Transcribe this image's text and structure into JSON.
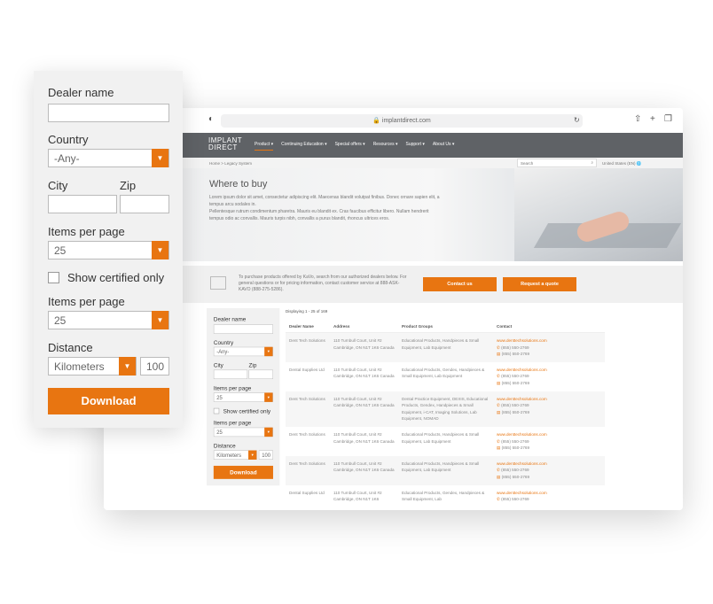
{
  "browser": {
    "url": "implantdirect.com"
  },
  "nav": {
    "logo_line1": "IMPLANT",
    "logo_line2": "DIRECT",
    "items": [
      "Product ▾",
      "Continuing Education ▾",
      "Special offers ▾",
      "Resources ▾",
      "Support ▾",
      "About Us ▾"
    ]
  },
  "breadcrumb": {
    "home": "Home",
    "sep": ">",
    "current": "Legacy System",
    "search_placeholder": "Search",
    "region": "United States (EN)"
  },
  "hero": {
    "title": "Where to buy",
    "p1": "Lorem ipsum dolor sit amet, consectetur adipiscing elit. Maecenas blandit volutpat finibus. Donec ornare sapien elit, a tempus arcu sodales in.",
    "p2": "Pellentesque rutrum condimentum pharetra. Mauris eu blandit ex. Cras faucibus efficitur libero. Nullam hendrerit tempus odio ac convallis. Mauris turpis nibh, convallis a purus blandit, rhoncus ultrices eros."
  },
  "contact_bar": {
    "text": "To purchase products offered by KaVo, search from our authorized dealers below. For general questions or for pricing information, contact customer service at 888-ASK-KAVO (888-275-5286).",
    "contact_button": "Contact us",
    "quote_button": "Request a quote"
  },
  "filters": {
    "dealer_name_label": "Dealer name",
    "dealer_name_value": "",
    "country_label": "Country",
    "country_value": "-Any-",
    "city_label": "City",
    "zip_label": "Zip",
    "items_label": "Items per page",
    "items_value": "25",
    "certified_label": "Show certified only",
    "items2_label": "Items per page",
    "items2_value": "25",
    "distance_label": "Distance",
    "distance_unit": "Kilometers",
    "distance_value": "100",
    "download": "Download"
  },
  "results": {
    "displaying": "Displaying 1 - 25 of 169",
    "headers": [
      "Dealer Name",
      "Address",
      "Product Groups",
      "Contact"
    ],
    "rows": [
      {
        "name": "Dent Tech Solutions",
        "address": "110 Turnbull Court, Unit #2 Cambridge, ON N1T 1K6 Canada",
        "groups": "Educational Products, Handpieces & Small Equipment, Lab Equipment",
        "web": "www.denttechsolutions.com",
        "phone": "(855) 550-2769",
        "fax": "(855) 550-2769"
      },
      {
        "name": "Dental Supplies Ltd",
        "address": "110 Turnbull Court, Unit #2 Cambridge, ON N1T 1K6 Canada",
        "groups": "Educational Products, Gendex, Handpieces & Small Equipment, Lab Equipment",
        "web": "www.denttechsolutions.com",
        "phone": "(855) 550-2769",
        "fax": "(855) 550-2769"
      },
      {
        "name": "Dent Tech Solutions",
        "address": "110 Turnbull Court, Unit #2 Cambridge, ON N1T 1K6 Canada",
        "groups": "Dental Practice Equipment, DEXIS, Educational Products, Gendex, Handpieces & Small Equipment, i-CAT, Imaging Solutions, Lab Equipment, NOMAD",
        "web": "www.denttechsolutions.com",
        "phone": "(855) 550-2769",
        "fax": "(855) 550-2769"
      },
      {
        "name": "Dent Tech Solutions",
        "address": "110 Turnbull Court, Unit #2 Cambridge, ON N1T 1K6 Canada",
        "groups": "Educational Products, Handpieces & Small Equipment, Lab Equipment",
        "web": "www.denttechsolutions.com",
        "phone": "(855) 550-2769",
        "fax": "(855) 550-2769"
      },
      {
        "name": "Dent Tech Solutions",
        "address": "110 Turnbull Court, Unit #2 Cambridge, ON N1T 1K6 Canada",
        "groups": "Educational Products, Handpieces & Small Equipment, Lab Equipment",
        "web": "www.denttechsolutions.com",
        "phone": "(855) 550-2769",
        "fax": "(855) 550-2769"
      },
      {
        "name": "Dental Supplies Ltd",
        "address": "110 Turnbull Court, Unit #2 Cambridge, ON N1T 1K6",
        "groups": "Educational Products, Gendex, Handpieces & Small Equipment, Lab",
        "web": "www.denttechsolutions.com",
        "phone": "(855) 550-2769",
        "fax": ""
      }
    ]
  },
  "colors": {
    "accent": "#e87511",
    "nav_bg": "#5f6266"
  }
}
